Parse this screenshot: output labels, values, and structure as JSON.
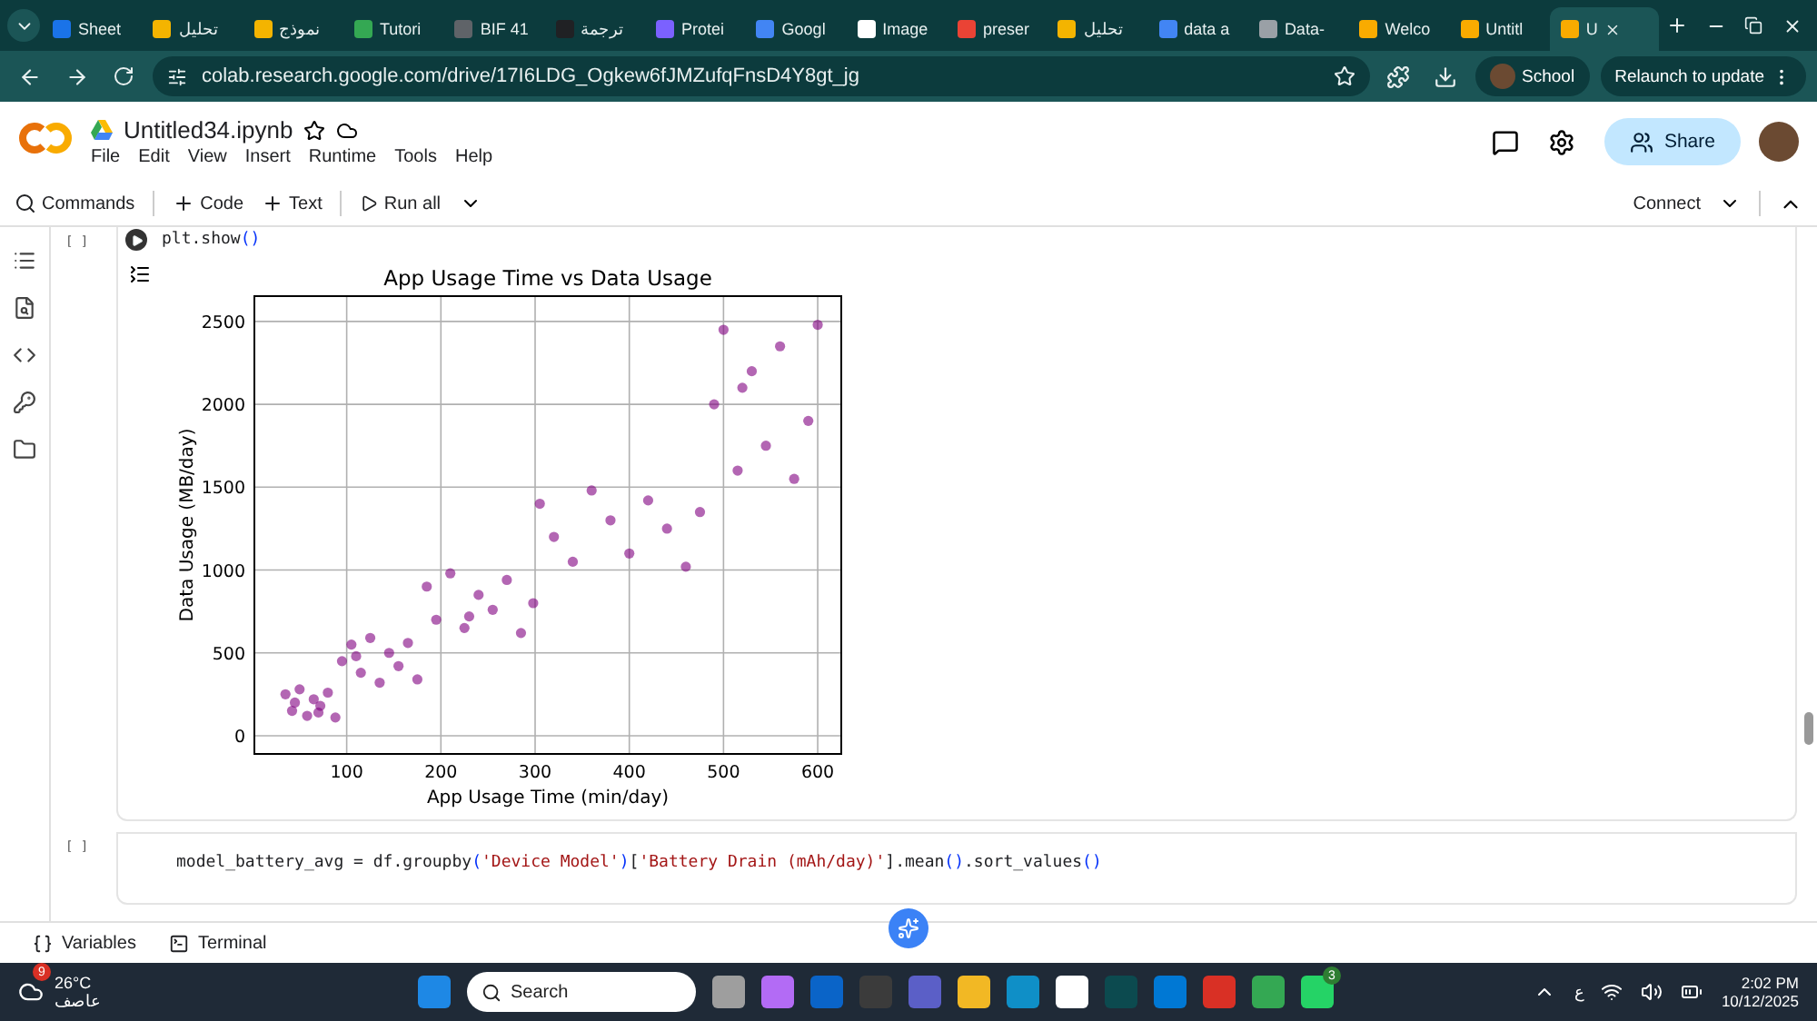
{
  "browser": {
    "tabs": [
      {
        "label": "Sheet",
        "color": "#1a73e8",
        "selected": false
      },
      {
        "label": "تحليل",
        "color": "#f4b400",
        "selected": false
      },
      {
        "label": "نموذج",
        "color": "#f4b400",
        "selected": false
      },
      {
        "label": "Tutori",
        "color": "#34a853",
        "selected": false
      },
      {
        "label": "BIF 41",
        "color": "#5f6368",
        "selected": false
      },
      {
        "label": "ترجمة",
        "color": "#202124",
        "selected": false
      },
      {
        "label": "Protei",
        "color": "#7b61ff",
        "selected": false
      },
      {
        "label": "Googl",
        "color": "#4285f4",
        "selected": false
      },
      {
        "label": "Image",
        "color": "#ffffff",
        "selected": false
      },
      {
        "label": "preser",
        "color": "#ea4335",
        "selected": false
      },
      {
        "label": "تحليل",
        "color": "#f4b400",
        "selected": false
      },
      {
        "label": "data a",
        "color": "#4285f4",
        "selected": false
      },
      {
        "label": "Data-",
        "color": "#9aa0a6",
        "selected": false
      },
      {
        "label": "Welco",
        "color": "#f9ab00",
        "selected": false
      },
      {
        "label": "Untitl",
        "color": "#f9ab00",
        "selected": false
      },
      {
        "label": "U",
        "color": "#f9ab00",
        "selected": true
      }
    ],
    "url": "colab.research.google.com/drive/17I6LDG_Ogkew6fJMZufqFnsD4Y8gt_jg",
    "profile": "School",
    "update_button": "Relaunch to update"
  },
  "notebook": {
    "title": "Untitled34.ipynb",
    "menu": [
      "File",
      "Edit",
      "View",
      "Insert",
      "Runtime",
      "Tools",
      "Help"
    ],
    "share": "Share"
  },
  "toolbar": {
    "commands": "Commands",
    "add_code": "Code",
    "add_text": "Text",
    "run_all": "Run all",
    "connect": "Connect"
  },
  "cells": [
    {
      "run_mark": "[ ]",
      "tokens": [
        {
          "kind": "plain",
          "text": "plt.show"
        },
        {
          "kind": "paren",
          "text": "()"
        }
      ],
      "output": {
        "chart_data": {
          "type": "scatter",
          "title": "App Usage Time vs Data Usage",
          "xlabel": "App Usage Time (min/day)",
          "ylabel": "Data Usage (MB/day)",
          "xlim": [
            2,
            625
          ],
          "ylim": [
            -110,
            2653
          ],
          "xticks": [
            100,
            200,
            300,
            400,
            500,
            600
          ],
          "yticks": [
            0,
            500,
            1000,
            1500,
            2000,
            2500
          ],
          "grid": true,
          "x": [
            35,
            42,
            50,
            58,
            65,
            72,
            80,
            88,
            45,
            70,
            95,
            105,
            115,
            125,
            135,
            145,
            155,
            165,
            175,
            110,
            185,
            195,
            210,
            225,
            240,
            255,
            270,
            285,
            298,
            230,
            305,
            320,
            340,
            360,
            380,
            400,
            420,
            440,
            460,
            475,
            490,
            500,
            515,
            530,
            545,
            560,
            575,
            590,
            600,
            520
          ],
          "series": [
            {
              "color": "#800080",
              "values": [
                250,
                150,
                280,
                120,
                220,
                180,
                260,
                110,
                200,
                140,
                450,
                550,
                380,
                590,
                320,
                500,
                420,
                560,
                340,
                480,
                900,
                700,
                980,
                650,
                850,
                760,
                940,
                620,
                800,
                720,
                1400,
                1200,
                1050,
                1480,
                1300,
                1100,
                1420,
                1250,
                1020,
                1350,
                2000,
                2450,
                1600,
                2200,
                1750,
                2350,
                1550,
                1900,
                2480,
                2100
              ]
            }
          ]
        }
      }
    },
    {
      "run_mark": "[ ]",
      "tokens": [
        {
          "kind": "plain",
          "text": "model_battery_avg = df.groupby"
        },
        {
          "kind": "paren",
          "text": "("
        },
        {
          "kind": "string",
          "text": "'Device Model'"
        },
        {
          "kind": "paren",
          "text": ")"
        },
        {
          "kind": "plain",
          "text": "["
        },
        {
          "kind": "string",
          "text": "'Battery Drain (mAh/day)'"
        },
        {
          "kind": "plain",
          "text": "].mean"
        },
        {
          "kind": "paren",
          "text": "()"
        },
        {
          "kind": "plain",
          "text": ".sort_values"
        },
        {
          "kind": "paren",
          "text": "()"
        }
      ]
    }
  ],
  "bottom_bar": {
    "variables": "Variables",
    "terminal": "Terminal"
  },
  "taskbar": {
    "weather_badge": "9",
    "temperature": "26°C",
    "condition": "عاصف",
    "search": "Search",
    "whatsapp_badge": "3",
    "input_language": "ع",
    "time": "2:02 PM",
    "date": "10/12/2025"
  }
}
